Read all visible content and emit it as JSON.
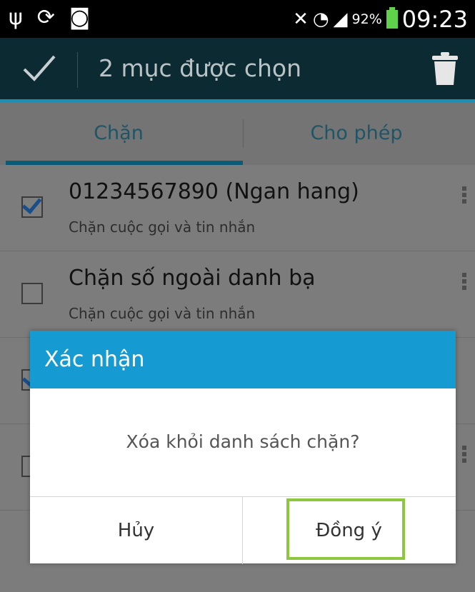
{
  "status_bar": {
    "left_icons": [
      "usb-icon",
      "sync-icon",
      "shopping-bag-icon"
    ],
    "right_icons": [
      "nfc-icon",
      "wifi-icon",
      "signal-icon"
    ],
    "battery_percent": "92%",
    "time": "09:23"
  },
  "action_bar": {
    "title": "2 mục được chọn"
  },
  "tabs": [
    {
      "label": "Chặn",
      "selected": true
    },
    {
      "label": "Cho phép",
      "selected": false
    }
  ],
  "list": [
    {
      "title": "01234567890 (Ngan hang)",
      "subtitle": "Chặn cuộc gọi và tin nhắn",
      "checked": true
    },
    {
      "title": "Chặn số ngoài danh bạ",
      "subtitle": "Chặn cuộc gọi và tin nhắn",
      "checked": false
    }
  ],
  "dialog": {
    "title": "Xác nhận",
    "message": "Xóa khỏi danh sách chặn?",
    "cancel_label": "Hủy",
    "ok_label": "Đồng ý"
  },
  "colors": {
    "accent": "#159bd2",
    "highlight": "#8dc63f"
  }
}
